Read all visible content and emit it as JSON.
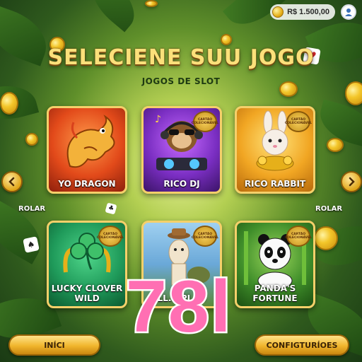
{
  "header": {
    "balance": "R$ 1.500,00",
    "avatar_icon": "user-avatar-icon"
  },
  "title": "SELECIENE SUU JOGO",
  "subtitle": "JOGOS DE SLOT",
  "games": [
    {
      "label": "YO DRAGON",
      "theme": "#d9411c",
      "badge": ""
    },
    {
      "label": "RICO DJ",
      "theme": "#6a2fb0",
      "badge": "CARTÃO COLECIONÁVEL"
    },
    {
      "label": "RICO RABBIT",
      "theme": "#f1a623",
      "badge": "CARTÃO COLECIONÁVEL"
    },
    {
      "label": "LUCKY CLOVER WILD",
      "theme": "#1f9a5a",
      "badge": "CARTÃO COLECIONÁVEL"
    },
    {
      "label": "LL... PI...S",
      "theme": "#6aa8d8",
      "badge": "CARTÃO COLECIONÁVEL"
    },
    {
      "label": "PANDA'S FORTUNE",
      "theme": "#3f8e2a",
      "badge": "CARTÃO COLECIONÁVEL"
    }
  ],
  "scroll_left_label": "ROLAR",
  "scroll_right_label": "ROLAR",
  "start_button": "INÍCI",
  "settings_button": "CONFIGTURÍOES",
  "overlay_number": "78l",
  "colors": {
    "gold": "#f5d06a",
    "overlay_pink": "#ff6fb3"
  }
}
